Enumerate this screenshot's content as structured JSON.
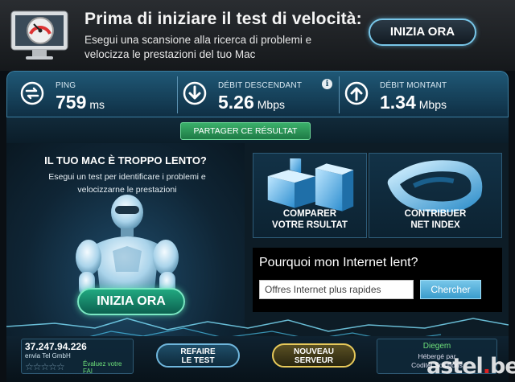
{
  "ad": {
    "title": "Prima di iniziare il test di velocità:",
    "subtitle": "Esegui una scansione alla ricerca di problemi e velocizza le prestazioni del tuo Mac",
    "cta": "INIZIA ORA",
    "icon": "mac-gauge-icon"
  },
  "stats": {
    "ping": {
      "label": "PING",
      "value": "759",
      "unit": "ms",
      "icon": "ping-arrows-icon"
    },
    "download": {
      "label": "DÉBIT DESCENDANT",
      "value": "5.26",
      "unit": "Mbps",
      "icon": "download-arrow-icon"
    },
    "upload": {
      "label": "DÉBIT MONTANT",
      "value": "1.34",
      "unit": "Mbps",
      "icon": "upload-arrow-icon"
    },
    "info_symbol": "i"
  },
  "share": {
    "label": "PARTAGER CE RÉSULTAT"
  },
  "promo": {
    "title": "IL TUO MAC È TROPPO LENTO?",
    "text": "Esegui un test per identificare i problemi e velocizzarne le prestazioni",
    "cta": "INIZIA ORA",
    "mascot": "robot-mascot"
  },
  "tiles": {
    "compare": {
      "line1": "COMPARER",
      "line2": "VOTRE RSULTAT",
      "icon": "bar-chart-icon"
    },
    "contribute": {
      "line1": "CONTRIBUER",
      "line2": "NET INDEX",
      "icon": "net-index-icon"
    }
  },
  "search": {
    "title": "Pourquoi mon Internet lent?",
    "input_value": "Offres Internet plus rapides",
    "button": "Chercher"
  },
  "isp": {
    "ip": "37.247.94.226",
    "name": "envia Tel GmbH",
    "stars": "☆☆☆☆☆",
    "rate_line1": "Évaluez votre",
    "rate_line2": "FAI"
  },
  "buttons": {
    "retest_line1": "REFAIRE",
    "retest_line2": "LE TEST",
    "server_line1": "NOUVEAU",
    "server_line2": "SERVEUR"
  },
  "server": {
    "city": "Diegem",
    "host1": "Hébergé par",
    "host2": "Coditel Solutions"
  },
  "watermark": {
    "text": "astel",
    "dot": ".",
    "tld": "be"
  },
  "colors": {
    "accent_blue": "#78c6e8",
    "accent_green": "#3bb06b",
    "server_gold": "#e7c95a",
    "link_green": "#6ee07a"
  }
}
